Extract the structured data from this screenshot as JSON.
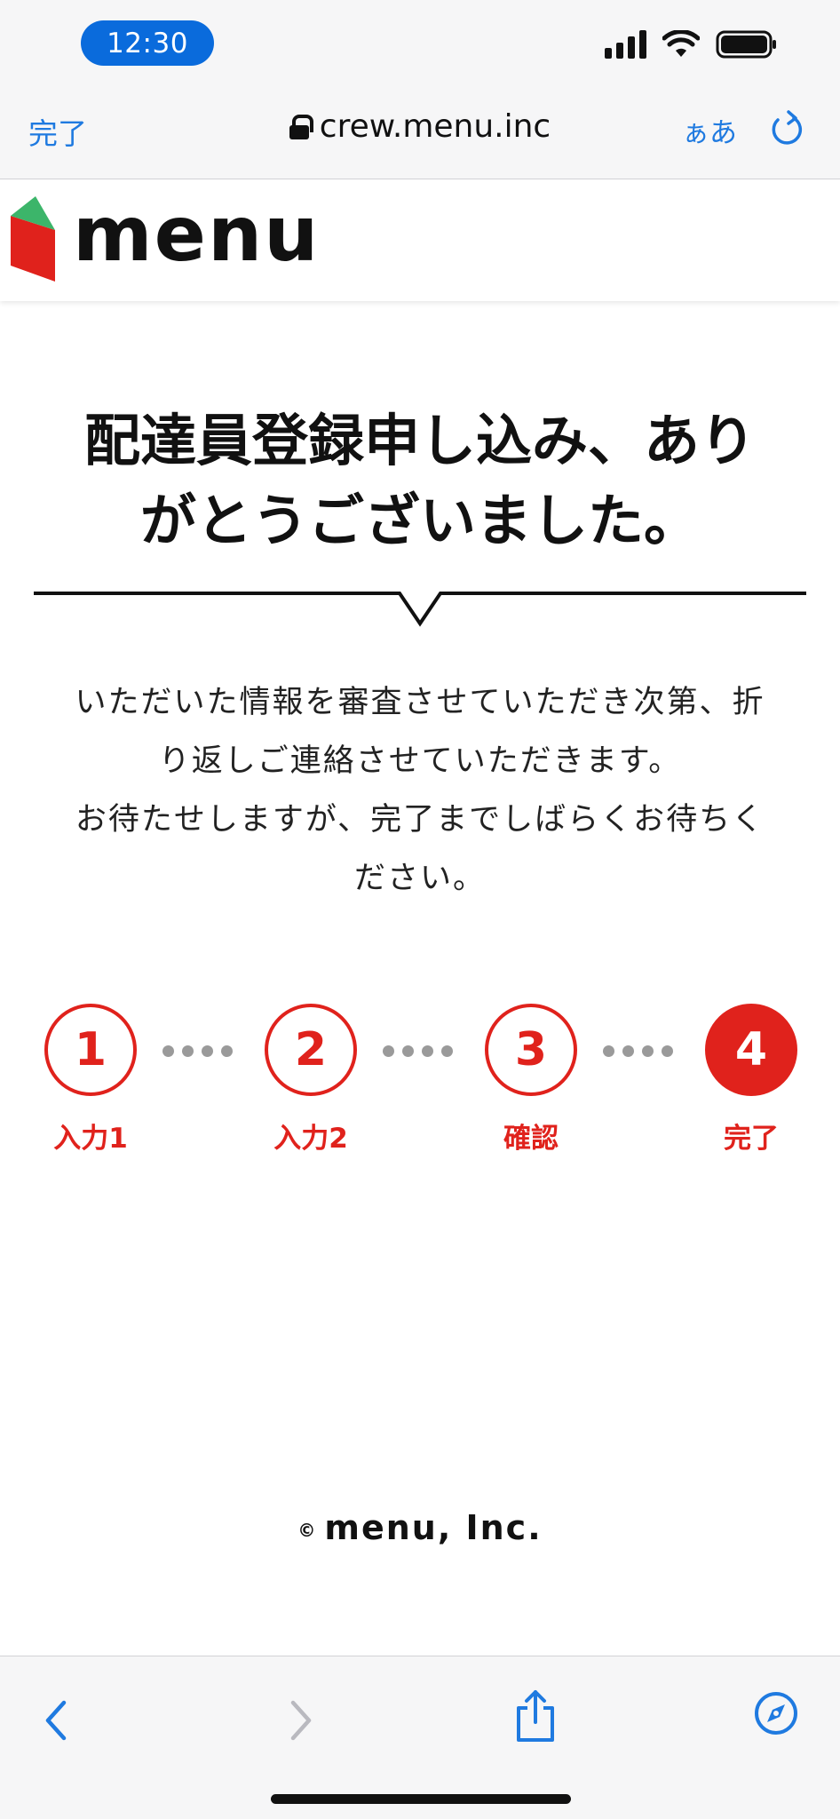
{
  "status_bar": {
    "time": "12:30"
  },
  "safari": {
    "done_label": "完了",
    "url": "crew.menu.inc",
    "aa_label": "ぁあ"
  },
  "site": {
    "logo_text": "menu"
  },
  "main": {
    "title_line1": "配達員登録申し込み、あり",
    "title_line2": "がとうございました。",
    "message_line1": "いただいた情報を審査させていただき次第、折",
    "message_line2": "り返しご連絡させていただきます。",
    "message_line3": "お待たせしますが、完了までしばらくお待ちく",
    "message_line4": "ださい。"
  },
  "steps": [
    {
      "number": "1",
      "label": "入力1",
      "active": false
    },
    {
      "number": "2",
      "label": "入力2",
      "active": false
    },
    {
      "number": "3",
      "label": "確認",
      "active": false
    },
    {
      "number": "4",
      "label": "完了",
      "active": true
    }
  ],
  "footer": {
    "copyright_symbol": "©",
    "copyright_text": "menu, Inc."
  },
  "colors": {
    "accent_red": "#e0221c",
    "ios_blue": "#1f7ae0",
    "logo_green": "#3cb56a"
  }
}
